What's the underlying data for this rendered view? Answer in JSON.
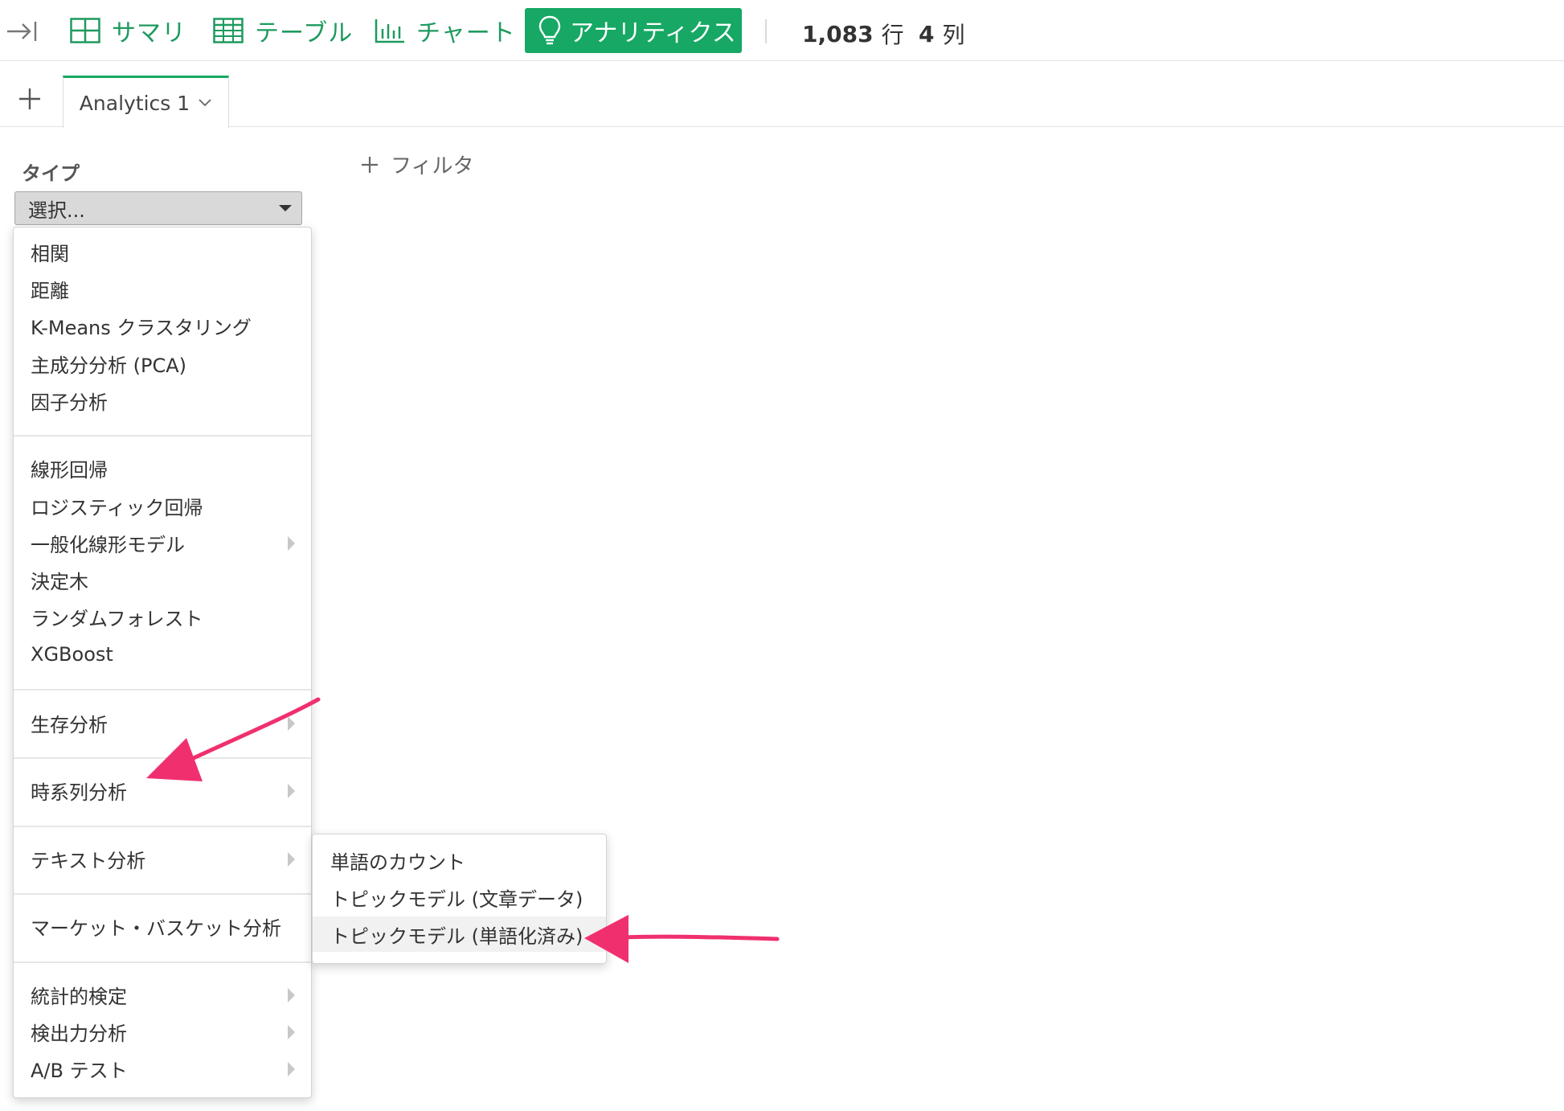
{
  "toolbar": {
    "summary_label": "サマリ",
    "table_label": "テーブル",
    "chart_label": "チャート",
    "analytics_label": "アナリティクス",
    "rows_value": "1,083",
    "rows_unit": "行",
    "cols_value": "4",
    "cols_unit": "列",
    "accent_color": "#16a864"
  },
  "tabs": {
    "active_label": "Analytics 1"
  },
  "panel": {
    "type_label": "タイプ",
    "select_value": "選択...",
    "filter_label": "フィルタ"
  },
  "menu": {
    "groups": [
      {
        "items": [
          {
            "label": "相関",
            "has_submenu": false
          },
          {
            "label": "距離",
            "has_submenu": false
          },
          {
            "label": "K-Means クラスタリング",
            "has_submenu": false
          },
          {
            "label": "主成分分析 (PCA)",
            "has_submenu": false
          },
          {
            "label": "因子分析",
            "has_submenu": false
          }
        ]
      },
      {
        "items": [
          {
            "label": "線形回帰",
            "has_submenu": false
          },
          {
            "label": "ロジスティック回帰",
            "has_submenu": false
          },
          {
            "label": "一般化線形モデル",
            "has_submenu": true
          },
          {
            "label": "決定木",
            "has_submenu": false
          },
          {
            "label": "ランダムフォレスト",
            "has_submenu": false
          },
          {
            "label": "XGBoost",
            "has_submenu": false
          }
        ]
      },
      {
        "items": [
          {
            "label": "生存分析",
            "has_submenu": true
          }
        ]
      },
      {
        "items": [
          {
            "label": "時系列分析",
            "has_submenu": true
          }
        ]
      },
      {
        "items": [
          {
            "label": "テキスト分析",
            "has_submenu": true
          }
        ]
      },
      {
        "items": [
          {
            "label": "マーケット・バスケット分析",
            "has_submenu": false
          }
        ]
      },
      {
        "items": [
          {
            "label": "統計的検定",
            "has_submenu": true
          },
          {
            "label": "検出力分析",
            "has_submenu": true
          },
          {
            "label": "A/B テスト",
            "has_submenu": true
          }
        ]
      }
    ]
  },
  "submenu": {
    "items": [
      {
        "label": "単語のカウント"
      },
      {
        "label": "トピックモデル (文章データ)"
      },
      {
        "label": "トピックモデル (単語化済み)"
      }
    ]
  },
  "annotation": {
    "arrow_color": "#f0306e"
  }
}
